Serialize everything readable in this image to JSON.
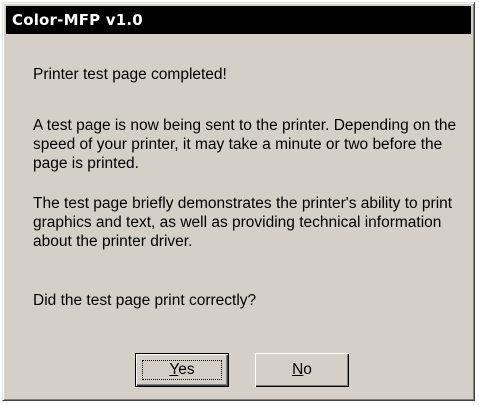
{
  "window": {
    "title": "Color-MFP v1.0"
  },
  "message": {
    "completed": "Printer test page completed!",
    "sending": "A test page is now being sent to the printer. Depending on the speed of your printer, it may take a minute or two before the page is printed.",
    "demo": "The test page briefly demonstrates the printer's ability to print graphics and text, as well as providing technical information about the printer driver.",
    "question": "Did the test page print correctly?"
  },
  "buttons": {
    "yes": {
      "mnemonic": "Y",
      "rest": "es"
    },
    "no": {
      "mnemonic": "N",
      "rest": "o"
    }
  },
  "colors": {
    "dialog_face": "#d4d0c8",
    "titlebar_bg": "#000000",
    "titlebar_text": "#ffffff"
  }
}
